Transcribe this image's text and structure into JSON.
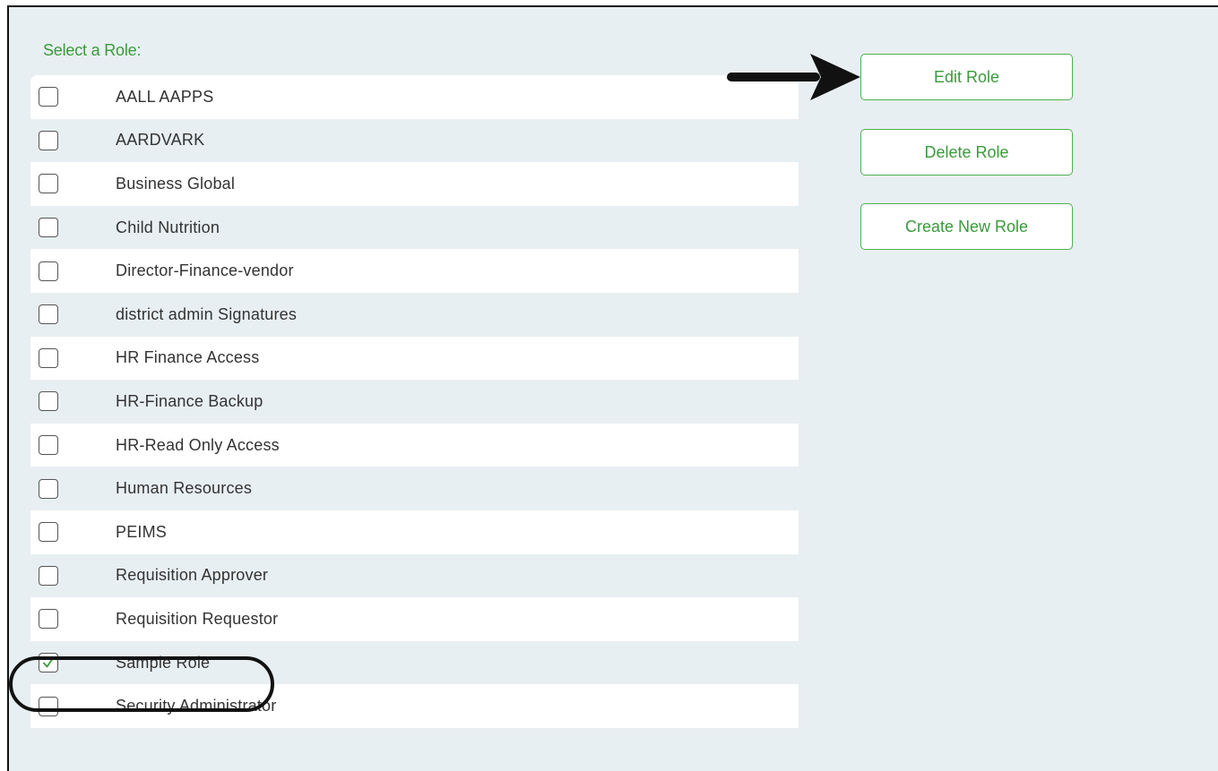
{
  "header": {
    "select_label": "Select a Role:"
  },
  "roles": [
    {
      "name": "AALL AAPPS",
      "checked": false
    },
    {
      "name": "AARDVARK",
      "checked": false
    },
    {
      "name": "Business Global",
      "checked": false
    },
    {
      "name": "Child Nutrition",
      "checked": false
    },
    {
      "name": "Director-Finance-vendor",
      "checked": false
    },
    {
      "name": "district admin Signatures",
      "checked": false
    },
    {
      "name": "HR Finance Access",
      "checked": false
    },
    {
      "name": "HR-Finance Backup",
      "checked": false
    },
    {
      "name": "HR-Read Only Access",
      "checked": false
    },
    {
      "name": "Human Resources",
      "checked": false
    },
    {
      "name": "PEIMS",
      "checked": false
    },
    {
      "name": "Requisition Approver",
      "checked": false
    },
    {
      "name": "Requisition Requestor",
      "checked": false
    },
    {
      "name": "Sample Role",
      "checked": true
    },
    {
      "name": "Security Administrator",
      "checked": false
    }
  ],
  "actions": {
    "edit_label": "Edit Role",
    "delete_label": "Delete Role",
    "create_label": "Create New Role"
  },
  "colors": {
    "accent": "#3a9a3a",
    "background": "#e8eff3",
    "annotation": "#111111"
  },
  "annotations": {
    "arrow_icon": "right-arrow-icon",
    "highlight_target": "Sample Role"
  }
}
